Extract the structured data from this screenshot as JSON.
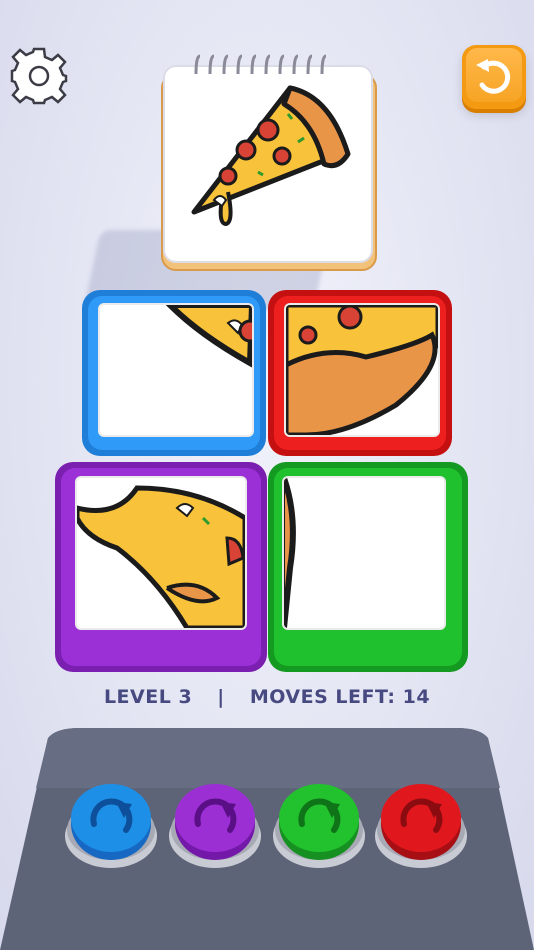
{
  "hud": {
    "settings_icon": "gear-icon",
    "restart_icon": "undo-icon"
  },
  "target_card": {
    "icon": "pizza-slice"
  },
  "tiles": [
    {
      "color": "#2f9af7",
      "name": "blue"
    },
    {
      "color": "#ee1f1f",
      "name": "red"
    },
    {
      "color": "#9b30d6",
      "name": "purple"
    },
    {
      "color": "#1fc22e",
      "name": "green"
    }
  ],
  "status": {
    "level": "LEVEL 3",
    "separator": "|",
    "moves": "MOVES LEFT: 14"
  },
  "rotate_buttons": [
    {
      "color": "#1e8fe6",
      "icon": "rotate-cw-icon"
    },
    {
      "color": "#9b2fd4",
      "icon": "rotate-cw-icon"
    },
    {
      "color": "#22c12e",
      "icon": "rotate-cw-icon"
    },
    {
      "color": "#e0181e",
      "icon": "rotate-cw-icon"
    }
  ]
}
